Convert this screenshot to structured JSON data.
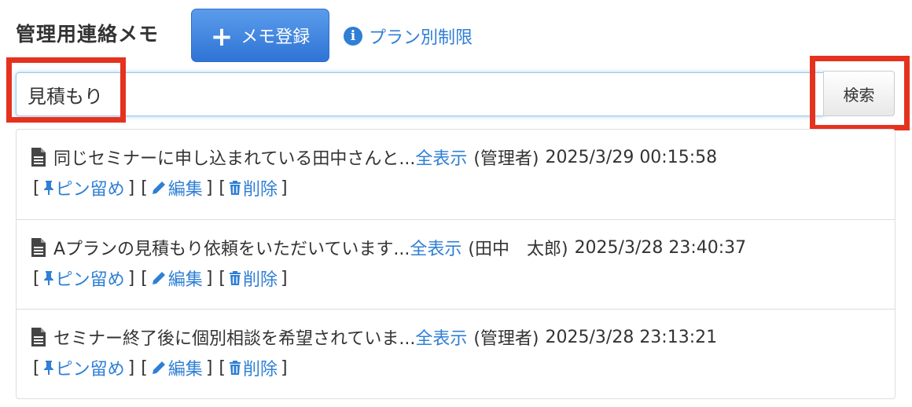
{
  "header": {
    "title": "管理用連絡メモ",
    "add_button_label": "メモ登録",
    "plan_link_label": "プラン別制限"
  },
  "search": {
    "value": "見積もり",
    "button_label": "検索"
  },
  "memos": [
    {
      "text": "同じセミナーに申し込まれている田中さんと...",
      "show_all": "全表示",
      "author": "(管理者)",
      "timestamp": "2025/3/29 00:15:58",
      "actions": {
        "pin": "ピン留め",
        "edit": "編集",
        "delete": "削除"
      }
    },
    {
      "text": "Aプランの見積もり依頼をいただいています...",
      "show_all": "全表示",
      "author": "(田中　太郎)",
      "timestamp": "2025/3/28 23:40:37",
      "actions": {
        "pin": "ピン留め",
        "edit": "編集",
        "delete": "削除"
      }
    },
    {
      "text": "セミナー終了後に個別相談を希望されていま...",
      "show_all": "全表示",
      "author": "(管理者)",
      "timestamp": "2025/3/28 23:13:21",
      "actions": {
        "pin": "ピン留め",
        "edit": "編集",
        "delete": "削除"
      }
    }
  ],
  "colors": {
    "primary_button": "#337ab7",
    "link": "#2f7fd4",
    "highlight": "#e5321e"
  },
  "icons": [
    "plus-icon",
    "info-icon",
    "document-icon",
    "pin-icon",
    "pencil-icon",
    "trash-icon"
  ]
}
